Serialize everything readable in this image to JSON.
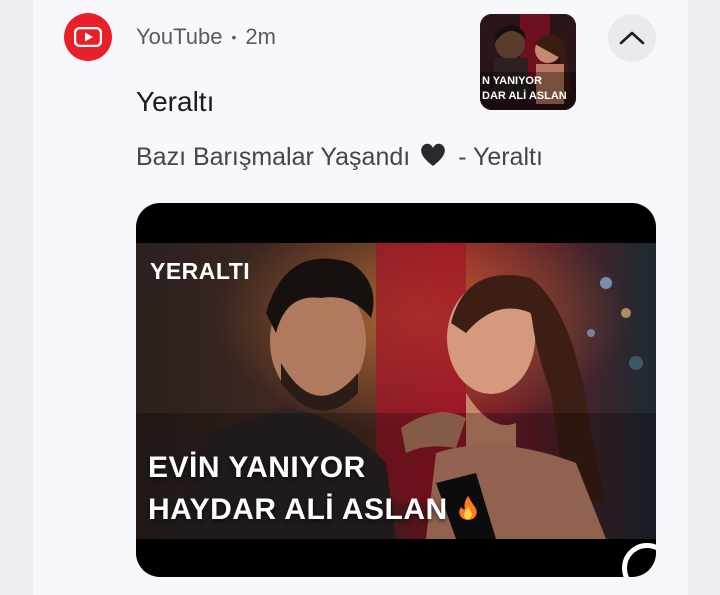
{
  "notification": {
    "app_name": "YouTube",
    "separator": "•",
    "time": "2m",
    "title": "Yeraltı",
    "body_before": "Bazı Barışmalar Yaşandı",
    "body_after": "- Yeraltı",
    "expand_icon": "chevron-up-icon",
    "app_icon": "youtube-icon"
  },
  "image": {
    "show_logo": "YERALTI",
    "line1": "EVİN YANIYOR",
    "line2": "HAYDAR ALİ ASLAN"
  },
  "thumbnail": {
    "line1": "N YANIYOR",
    "line2": "DAR ALİ ASLAN"
  },
  "colors": {
    "brand_red": "#e8202a",
    "card_bg": "#f8f7fc"
  }
}
